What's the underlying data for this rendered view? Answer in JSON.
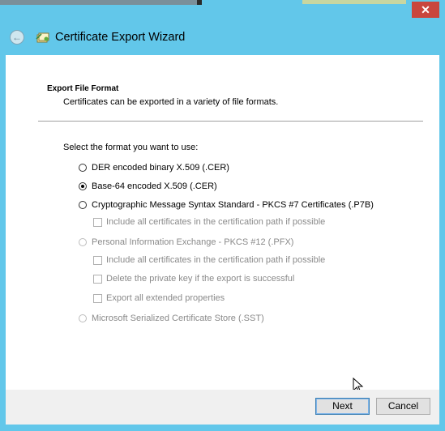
{
  "window": {
    "title": "Certificate Export Wizard",
    "close_glyph": "✕",
    "back_glyph": "←"
  },
  "page": {
    "section_title": "Export File Format",
    "section_desc": "Certificates can be exported in a variety of file formats.",
    "prompt": "Select the format you want to use:"
  },
  "options": {
    "der": "DER encoded binary X.509 (.CER)",
    "base64": "Base-64 encoded X.509 (.CER)",
    "pkcs7": "Cryptographic Message Syntax Standard - PKCS #7 Certificates (.P7B)",
    "pkcs7_include": "Include all certificates in the certification path if possible",
    "pfx": "Personal Information Exchange - PKCS #12 (.PFX)",
    "pfx_include": "Include all certificates in the certification path if possible",
    "pfx_delete": "Delete the private key if the export is successful",
    "pfx_export_ext": "Export all extended properties",
    "sst": "Microsoft Serialized Certificate Store (.SST)"
  },
  "selected_option": "base64",
  "buttons": {
    "next": "Next",
    "cancel": "Cancel"
  },
  "colors": {
    "titlebar": "#62c7ea",
    "close": "#c9463d"
  }
}
